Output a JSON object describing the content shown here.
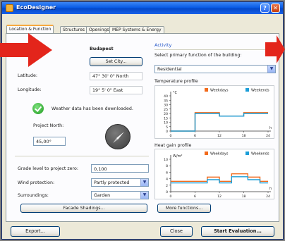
{
  "window": {
    "title": "EcoDesigner"
  },
  "tabs": [
    {
      "label": "Location & Function",
      "active": true
    },
    {
      "label": "Structures",
      "active": false
    },
    {
      "label": "Openings",
      "active": false
    },
    {
      "label": "MEP Systems & Energy",
      "active": false
    }
  ],
  "location": {
    "city": "Budapest",
    "set_city_label": "Set City...",
    "latitude_label": "Latitude:",
    "latitude_value": "47° 30' 0\" North",
    "longitude_label": "Longitude:",
    "longitude_value": "19° 5' 0\" East",
    "weather_status": "Weather data has been downloaded.",
    "project_north_label": "Project North:",
    "project_north_value": "45,00°",
    "grade_label": "Grade level to project zero:",
    "grade_value": "0,100",
    "wind_label": "Wind protection:",
    "wind_value": "Partly protected",
    "surroundings_label": "Surroundings:",
    "surroundings_value": "Garden",
    "facade_button": "Facade Shadings..."
  },
  "activity": {
    "group_title": "Activity",
    "primary_function_label": "Select primary function of the building:",
    "primary_function_value": "Residential",
    "temp_profile_label": "Temperature profile",
    "heat_profile_label": "Heat gain profile",
    "more_functions_label": "More functions..."
  },
  "chart_data": [
    {
      "type": "line",
      "title": "",
      "ylabel": "°C",
      "xlabel": "h",
      "ylim": [
        0,
        40
      ],
      "yticks": [
        0,
        5,
        10,
        15,
        20,
        25,
        30,
        35,
        40
      ],
      "xticks": [
        0,
        6,
        12,
        18,
        24
      ],
      "grid": false,
      "legend": "top",
      "series": [
        {
          "name": "Weekdays",
          "color": "#f26a1b",
          "x": [
            0,
            6,
            6,
            12,
            12,
            18,
            18,
            24
          ],
          "values": [
            0,
            0,
            21,
            21,
            17,
            17,
            21,
            21
          ]
        },
        {
          "name": "Weekends",
          "color": "#1c9ed8",
          "x": [
            0,
            6,
            6,
            12,
            12,
            18,
            18,
            24
          ],
          "values": [
            0,
            0,
            20,
            20,
            17,
            17,
            20,
            20
          ]
        }
      ]
    },
    {
      "type": "line",
      "title": "",
      "ylabel": "W/m²",
      "xlabel": "h",
      "ylim": [
        0,
        10
      ],
      "yticks": [
        0,
        2,
        4,
        6,
        8,
        10
      ],
      "xticks": [
        0,
        6,
        12,
        18,
        24
      ],
      "grid": false,
      "legend": "top",
      "series": [
        {
          "name": "Weekdays",
          "color": "#f26a1b",
          "x": [
            0,
            6,
            6,
            9,
            9,
            12,
            12,
            15,
            15,
            19,
            19,
            22,
            22,
            24
          ],
          "values": [
            3.2,
            3.2,
            3.2,
            3.2,
            4.5,
            4.5,
            3.2,
            3.2,
            5.5,
            5.5,
            4.5,
            4.5,
            3.2,
            3.2
          ]
        },
        {
          "name": "Weekends",
          "color": "#1c9ed8",
          "x": [
            0,
            6,
            6,
            9,
            9,
            12,
            12,
            15,
            15,
            19,
            19,
            22,
            22,
            24
          ],
          "values": [
            2.7,
            2.7,
            2.7,
            2.7,
            3.7,
            3.7,
            2.7,
            2.7,
            4.6,
            4.6,
            3.7,
            3.7,
            2.7,
            2.7
          ]
        }
      ]
    }
  ],
  "footer": {
    "export_label": "Export...",
    "close_label": "Close",
    "start_label": "Start Evaluation..."
  },
  "colors": {
    "title_bar": "#0a5ce6",
    "tab_highlight": "#f7a93f",
    "arrow": "#e3251b",
    "weekdays": "#f26a1b",
    "weekends": "#1c9ed8"
  }
}
